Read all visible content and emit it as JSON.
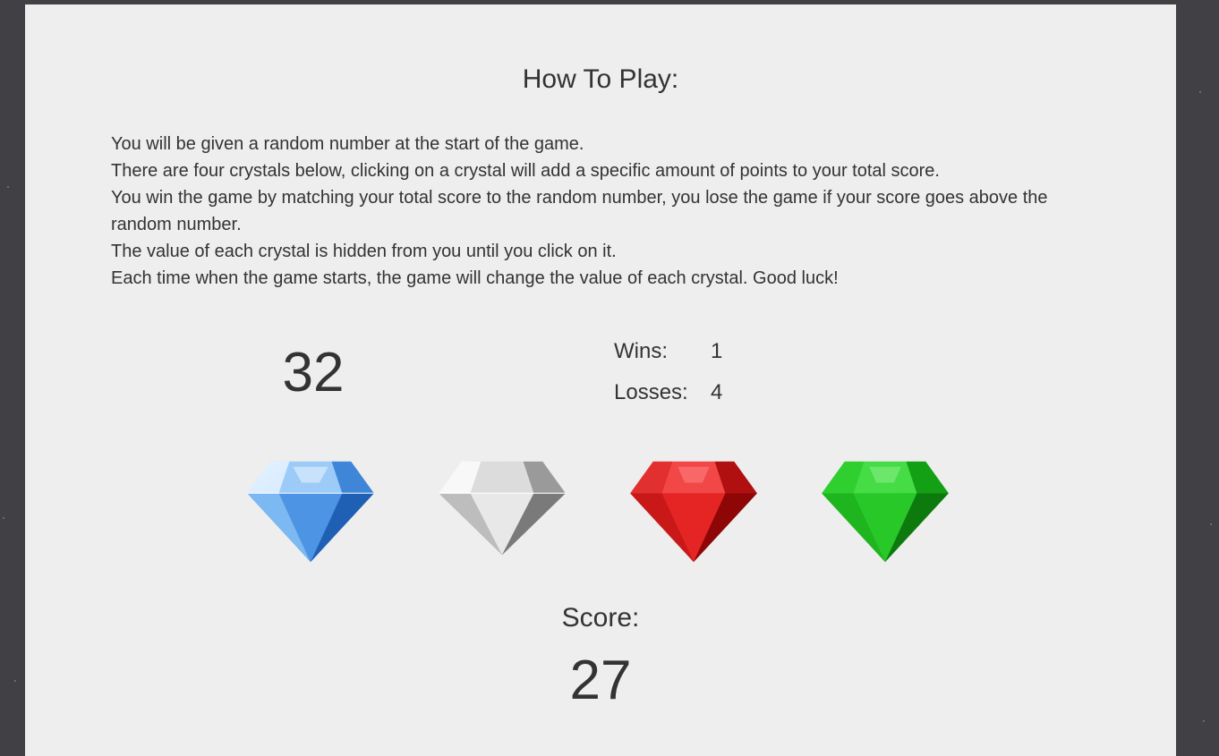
{
  "instructions": {
    "title": "How To Play:",
    "lines": [
      "You will be given a random number at the start of the game.",
      "There are four crystals below, clicking on a crystal will add a specific amount of points to your total score.",
      "You win the game by matching your total score to the random number, you lose the game if your score goes above the random number.",
      "The value of each crystal is hidden from you until you click on it.",
      "Each time when the game starts, the game will change the value of each crystal. Good luck!"
    ]
  },
  "game": {
    "target_number": "32",
    "wins_label": "Wins:",
    "wins": "1",
    "losses_label": "Losses:",
    "losses": "4",
    "score_label": "Score:",
    "score": "27"
  },
  "crystals": [
    {
      "name": "blue-crystal",
      "color": "#4a90e2"
    },
    {
      "name": "white-crystal",
      "color": "#d8d8d8"
    },
    {
      "name": "red-crystal",
      "color": "#d9191c"
    },
    {
      "name": "green-crystal",
      "color": "#1fbf1f"
    }
  ],
  "colors": {
    "background": "#404045",
    "panel": "#eeeeee",
    "text": "#333333"
  }
}
